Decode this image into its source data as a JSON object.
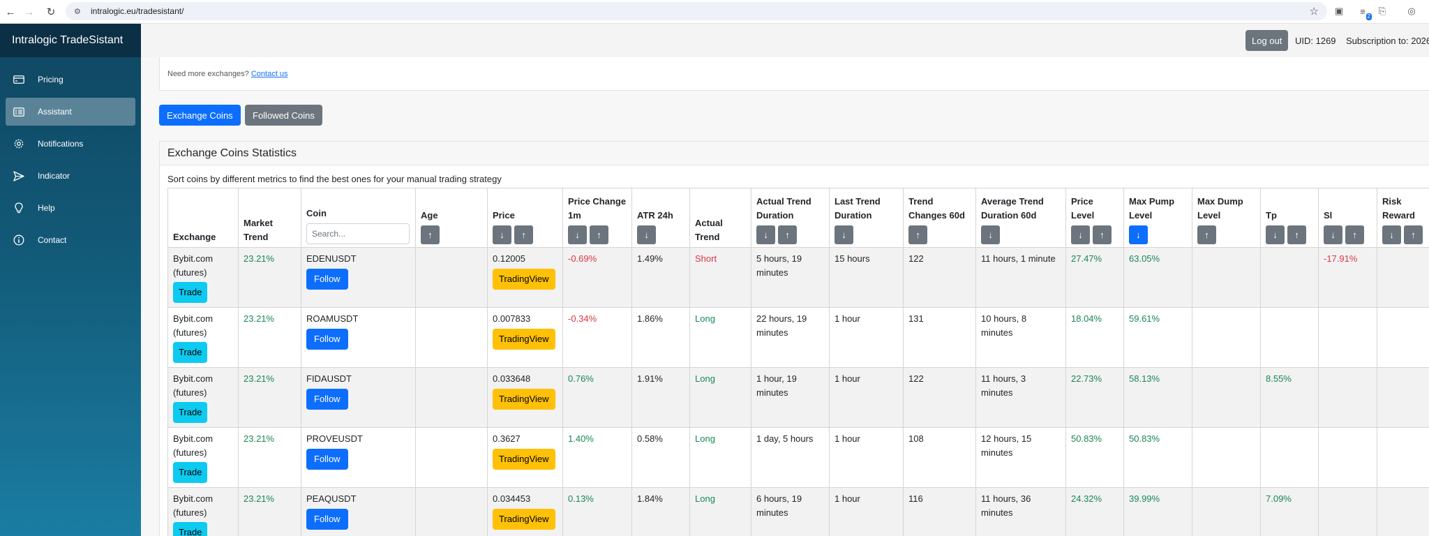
{
  "browser": {
    "url": "intralogic.eu/tradesistant/",
    "ext_badge": "2"
  },
  "sidebar": {
    "brand": "Intralogic TradeSistant",
    "items": [
      {
        "label": "Pricing",
        "icon": "credit-card-icon"
      },
      {
        "label": "Assistant",
        "icon": "card-list-icon",
        "active": true
      },
      {
        "label": "Notifications",
        "icon": "gear-icon"
      },
      {
        "label": "Indicator",
        "icon": "send-icon"
      },
      {
        "label": "Help",
        "icon": "lightbulb-icon"
      },
      {
        "label": "Contact",
        "icon": "info-circle-icon"
      }
    ]
  },
  "topbar": {
    "logout_label": "Log out",
    "uid_text": "UID: 1269",
    "subscription_text": "Subscription to: 2026"
  },
  "notice": {
    "text": "Need more exchanges?",
    "link": "Contact us"
  },
  "tabs": {
    "exchange": "Exchange Coins",
    "followed": "Followed Coins"
  },
  "stats": {
    "title": "Exchange Coins Statistics",
    "description": "Sort coins by different metrics to find the best ones for your manual trading strategy",
    "search_placeholder": "Search...",
    "headers": [
      {
        "line1": "Exchange",
        "line2": ""
      },
      {
        "line1": "Market",
        "line2": "Trend"
      },
      {
        "line1": "Coin",
        "line2": ""
      },
      {
        "line1": "Age",
        "line2": ""
      },
      {
        "line1": "Price",
        "line2": ""
      },
      {
        "line1": "Price Change",
        "line2": "1m"
      },
      {
        "line1": "ATR 24h",
        "line2": ""
      },
      {
        "line1": "Actual",
        "line2": "Trend"
      },
      {
        "line1": "Actual Trend",
        "line2": "Duration"
      },
      {
        "line1": "Last Trend",
        "line2": "Duration"
      },
      {
        "line1": "Trend",
        "line2": "Changes 60d"
      },
      {
        "line1": "Average Trend",
        "line2": "Duration 60d"
      },
      {
        "line1": "Price Level",
        "line2": ""
      },
      {
        "line1": "Max Pump",
        "line2": "Level"
      },
      {
        "line1": "Max Dump",
        "line2": "Level"
      },
      {
        "line1": "Tp",
        "line2": ""
      },
      {
        "line1": "Sl",
        "line2": ""
      },
      {
        "line1": "Risk",
        "line2": "Reward"
      }
    ],
    "sort_down": "↓",
    "sort_up": "↑",
    "button_labels": {
      "trade": "Trade",
      "follow": "Follow",
      "tradingview": "TradingView"
    },
    "rows": [
      {
        "exchange_l1": "Bybit.com",
        "exchange_l2": "(futures)",
        "market_trend": "23.21%",
        "coin": "EDENUSDT",
        "age": "",
        "price": "0.12005",
        "price_change": "-0.69%",
        "atr": "1.49%",
        "actual_trend": "Short",
        "actual_dur_l1": "5 hours, 19",
        "actual_dur_l2": "minutes",
        "last_dur": "15 hours",
        "changes": "122",
        "avg_dur_l1": "11 hours, 1 minute",
        "avg_dur_l2": "",
        "price_level": "27.47%",
        "max_pump": "63.05%",
        "max_dump": "",
        "tp": "",
        "sl": "-17.91%",
        "rr": ""
      },
      {
        "exchange_l1": "Bybit.com",
        "exchange_l2": "(futures)",
        "market_trend": "23.21%",
        "coin": "ROAMUSDT",
        "age": "",
        "price": "0.007833",
        "price_change": "-0.34%",
        "atr": "1.86%",
        "actual_trend": "Long",
        "actual_dur_l1": "22 hours, 19",
        "actual_dur_l2": "minutes",
        "last_dur": "1 hour",
        "changes": "131",
        "avg_dur_l1": "10 hours, 8",
        "avg_dur_l2": "minutes",
        "price_level": "18.04%",
        "max_pump": "59.61%",
        "max_dump": "",
        "tp": "",
        "sl": "",
        "rr": ""
      },
      {
        "exchange_l1": "Bybit.com",
        "exchange_l2": "(futures)",
        "market_trend": "23.21%",
        "coin": "FIDAUSDT",
        "age": "",
        "price": "0.033648",
        "price_change": "0.76%",
        "atr": "1.91%",
        "actual_trend": "Long",
        "actual_dur_l1": "1 hour, 19",
        "actual_dur_l2": "minutes",
        "last_dur": "1 hour",
        "changes": "122",
        "avg_dur_l1": "11 hours, 3",
        "avg_dur_l2": "minutes",
        "price_level": "22.73%",
        "max_pump": "58.13%",
        "max_dump": "",
        "tp": "8.55%",
        "sl": "",
        "rr": ""
      },
      {
        "exchange_l1": "Bybit.com",
        "exchange_l2": "(futures)",
        "market_trend": "23.21%",
        "coin": "PROVEUSDT",
        "age": "",
        "price": "0.3627",
        "price_change": "1.40%",
        "atr": "0.58%",
        "actual_trend": "Long",
        "actual_dur_l1": "1 day, 5 hours",
        "actual_dur_l2": "",
        "last_dur": "1 hour",
        "changes": "108",
        "avg_dur_l1": "12 hours, 15",
        "avg_dur_l2": "minutes",
        "price_level": "50.83%",
        "max_pump": "50.83%",
        "max_dump": "",
        "tp": "",
        "sl": "",
        "rr": ""
      },
      {
        "exchange_l1": "Bybit.com",
        "exchange_l2": "(futures)",
        "market_trend": "23.21%",
        "coin": "PEAQUSDT",
        "age": "",
        "price": "0.034453",
        "price_change": "0.13%",
        "atr": "1.84%",
        "actual_trend": "Long",
        "actual_dur_l1": "6 hours, 19",
        "actual_dur_l2": "minutes",
        "last_dur": "1 hour",
        "changes": "116",
        "avg_dur_l1": "11 hours, 36",
        "avg_dur_l2": "minutes",
        "price_level": "24.32%",
        "max_pump": "39.99%",
        "max_dump": "",
        "tp": "7.09%",
        "sl": "",
        "rr": ""
      }
    ]
  },
  "colors": {
    "positive": "#198754",
    "negative": "#dc3545",
    "primary": "#0d6efd",
    "secondary": "#6c757d",
    "info": "#0dcaf0",
    "warning": "#ffc107"
  }
}
